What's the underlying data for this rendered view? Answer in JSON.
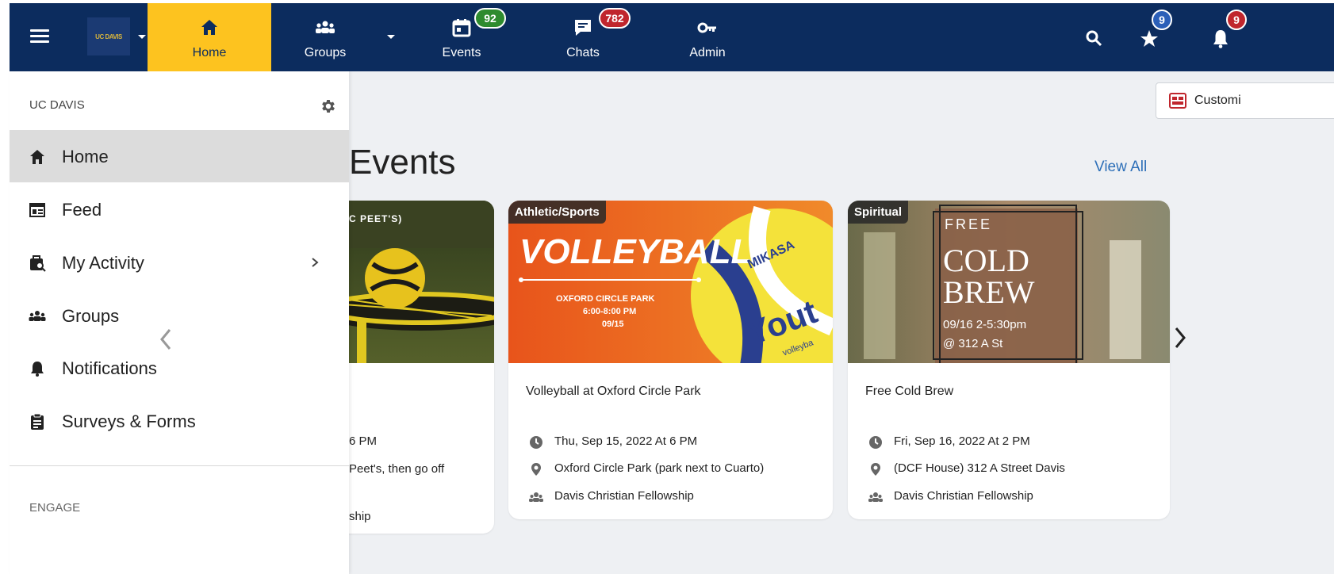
{
  "topnav": {
    "logo_text": "UC DAVIS",
    "items": [
      {
        "label": "Home",
        "icon": "home-icon"
      },
      {
        "label": "Groups",
        "icon": "groups-icon"
      },
      {
        "label": "Events",
        "icon": "calendar-icon",
        "badge": "92"
      },
      {
        "label": "Chats",
        "icon": "chat-icon",
        "badge": "782"
      },
      {
        "label": "Admin",
        "icon": "key-icon"
      }
    ],
    "star_badge": "9",
    "bell_badge": "9",
    "colors": {
      "bar": "#0c2c5e",
      "active": "#fdc31f",
      "badge_green": "#2e8b2e",
      "badge_red": "#c0262d"
    }
  },
  "drawer": {
    "heading": "UC DAVIS",
    "items": [
      {
        "label": "Home",
        "icon": "home-icon",
        "active": true
      },
      {
        "label": "Feed",
        "icon": "feed-icon"
      },
      {
        "label": "My Activity",
        "icon": "activity-icon",
        "has_submenu": true
      },
      {
        "label": "Groups",
        "icon": "groups-icon"
      },
      {
        "label": "Notifications",
        "icon": "bell-icon"
      },
      {
        "label": "Surveys & Forms",
        "icon": "clipboard-icon"
      }
    ],
    "section_engage": "ENGAGE"
  },
  "main": {
    "customize_label": "Customi",
    "section_title": "Events",
    "view_all": "View All",
    "cards": [
      {
        "image_text": "C PEET'S)",
        "time_partial": "6 PM",
        "location_partial": "Peet's, then go off",
        "group_partial": "ship"
      },
      {
        "category": "Athletic/Sports",
        "image_headline": "VOLLEYBALL",
        "image_place": "OXFORD CIRCLE PARK",
        "image_time": "6:00-8:00 PM",
        "image_date": "09/15",
        "ball_brand": "MIKASA",
        "ball_text": "Yout",
        "ball_text2": "volleyba",
        "title": "Volleyball at Oxford Circle Park",
        "datetime": "Thu, Sep 15, 2022 At 6 PM",
        "location": "Oxford Circle Park (park next to Cuarto)",
        "group": "Davis Christian Fellowship"
      },
      {
        "category": "Spiritual",
        "image_free": "FREE",
        "image_cold": "COLD",
        "image_brew": "BREW",
        "image_when": "09/16 2-5:30pm",
        "image_where": "@ 312 A St",
        "title": "Free Cold Brew",
        "datetime": "Fri, Sep 16, 2022 At 2 PM",
        "location": "(DCF House) 312 A Street Davis",
        "group": "Davis Christian Fellowship"
      }
    ]
  }
}
